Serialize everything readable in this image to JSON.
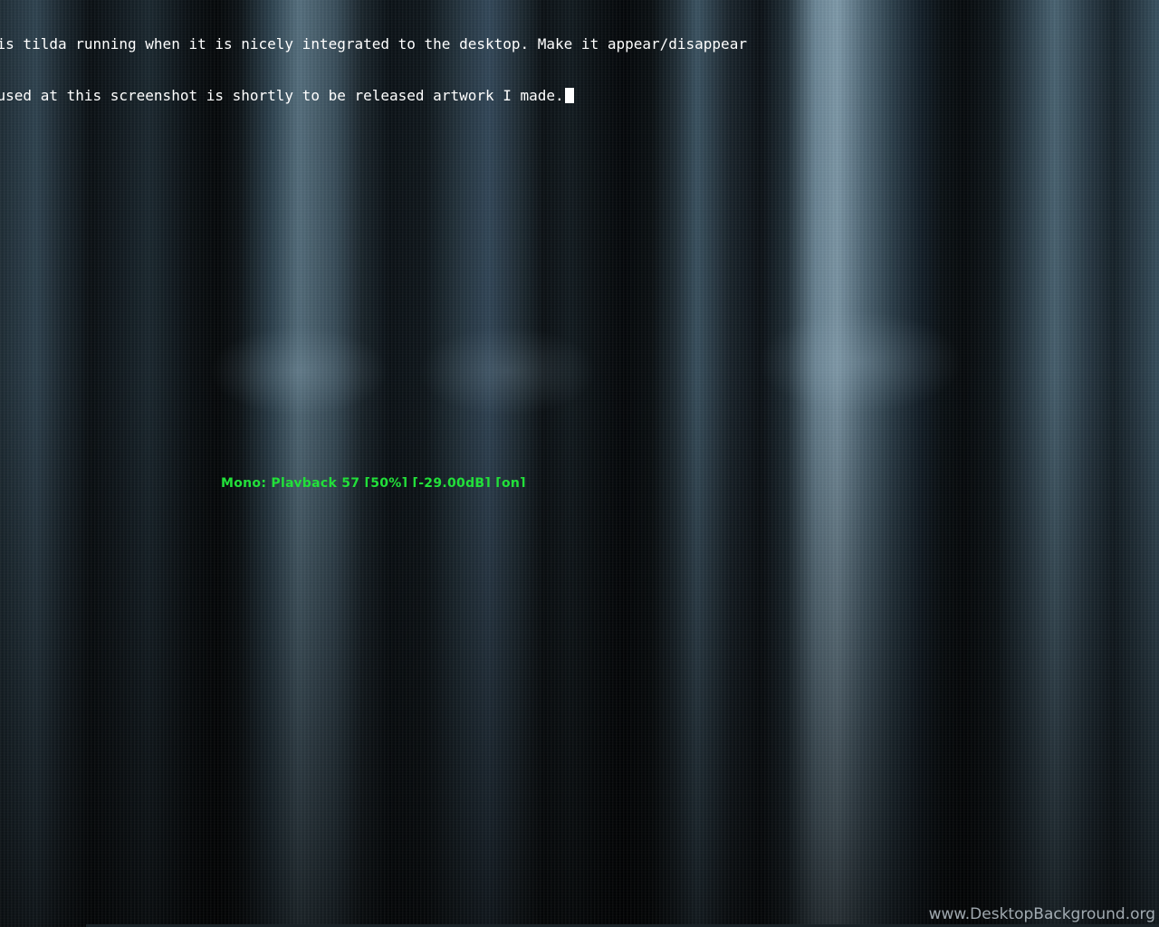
{
  "terminal": {
    "lines": [
      "his is tilda running when it is nicely integrated to the desktop. Make it appear/disappear",
      "und used at this screenshot is shortly to be released artwork I made."
    ]
  },
  "osd": {
    "volume_text": "Mono: Playback 57 [50%] [-29.00dB] [on]"
  },
  "watermark": {
    "text": "www.DesktopBackground.org"
  },
  "colors": {
    "terminal_text": "#ffffff",
    "osd_text": "#22e03a"
  }
}
